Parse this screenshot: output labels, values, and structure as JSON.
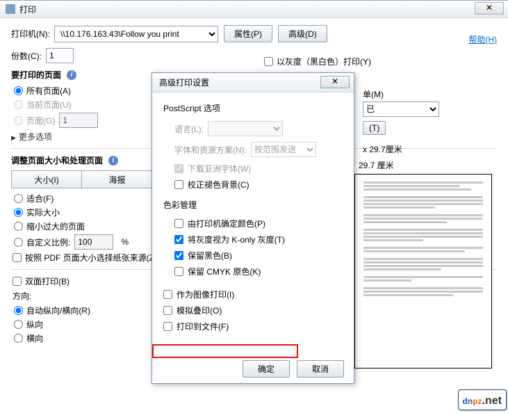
{
  "main": {
    "title": "打印",
    "close_glyph": "✕",
    "printer_label": "打印机(N):",
    "printer_value": "\\\\10.176.163.43\\Follow you print",
    "properties_btn": "属性(P)",
    "advanced_btn": "高级(D)",
    "help_link": "帮助(H)",
    "copies_label": "份数(C):",
    "copies_value": "1"
  },
  "right_opts": {
    "grayscale": "以灰度（黑白色）打印(Y)",
    "unit_label_fragment": "单(M)",
    "unit_select_fragment": "已",
    "unit_btn_fragment": "(T)",
    "dims1": "x 29.7厘米",
    "dims2": "29.7 厘米"
  },
  "pages": {
    "header": "要打印的页面",
    "all": "所有页面(A)",
    "current": "当前页面(U)",
    "range": "页面(G)",
    "range_value": "1",
    "more": "更多选项"
  },
  "sizing": {
    "header": "调整页面大小和处理页面",
    "size_btn": "大小(I)",
    "poster_btn": "海报",
    "fit": "适合(F)",
    "actual": "实际大小",
    "shrink": "缩小过大的页面",
    "custom": "自定义比例:",
    "custom_value": "100",
    "percent": "%",
    "pdf_select": "按照 PDF 页面大小选择纸张来源(Z"
  },
  "duplex": {
    "duplex": "双面打印(B)",
    "orientation_label": "方向:",
    "auto": "自动纵向/横向(R)",
    "portrait": "纵向",
    "landscape": "横向"
  },
  "advanced_dialog": {
    "title": "高级打印设置",
    "close_glyph": "✕",
    "postscript_header": "PostScript 选项",
    "language_label": "语言(L):",
    "language_value": "",
    "font_label": "字体和资源方案(N):",
    "font_value": "按范围发送",
    "download_asian": "下载亚洲字体(W)",
    "correct_bg": "校正褪色背景(C)",
    "color_header": "色彩管理",
    "printer_decides": "由打印机确定颜色(P)",
    "k_only": "将灰度视为 K-only 灰度(T)",
    "preserve_black": "保留黑色(B)",
    "preserve_cmyk": "保留 CMYK 原色(K)",
    "as_image": "作为图像打印(I)",
    "simulate_overprint": "模拟叠印(O)",
    "print_to_file": "打印到文件(F)",
    "ok": "确定",
    "cancel": "取消"
  },
  "watermark": {
    "dn": "dn",
    "pz": "pz",
    "net": ".net"
  }
}
